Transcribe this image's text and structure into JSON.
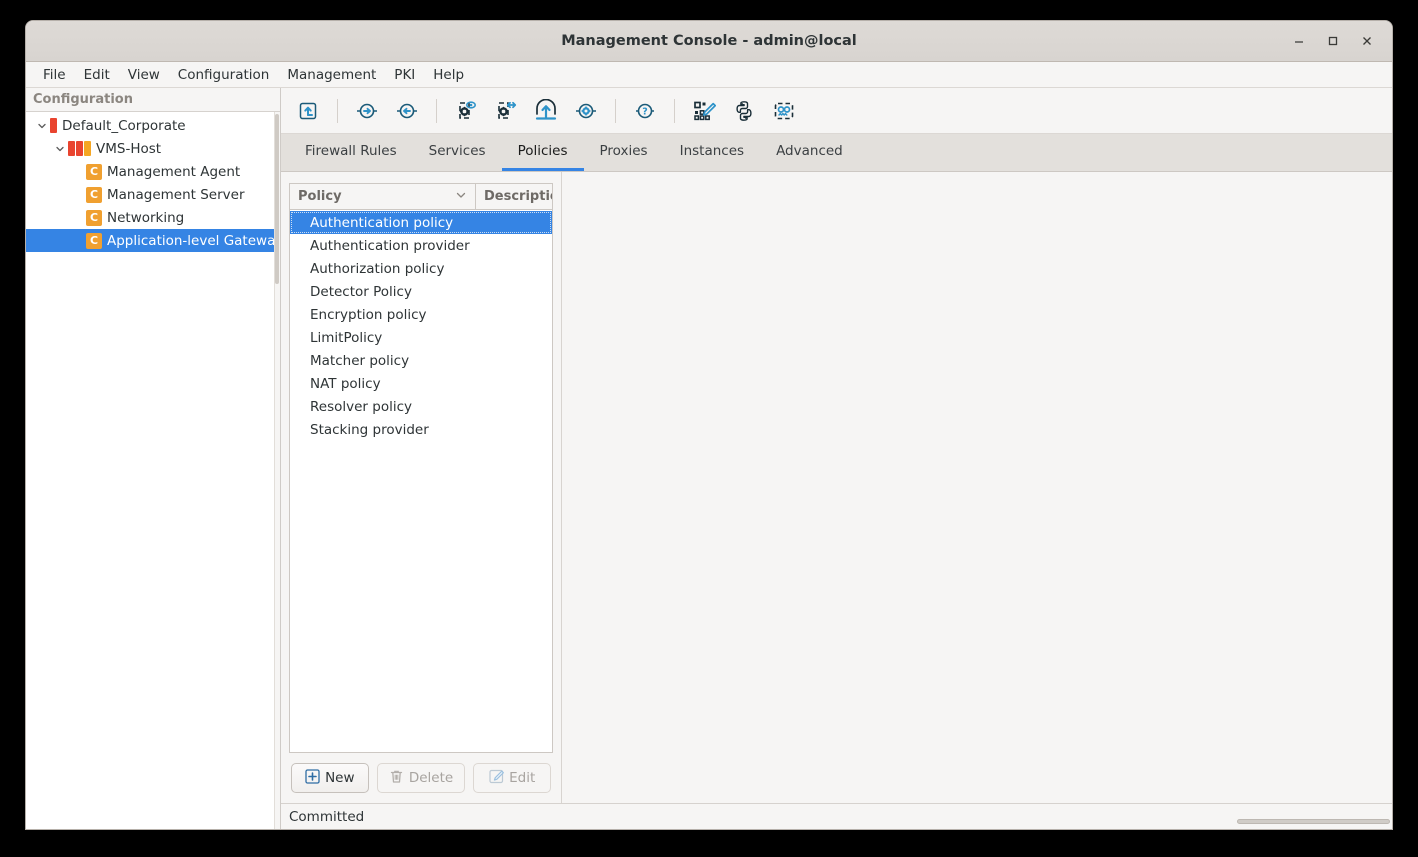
{
  "window": {
    "title": "Management Console - admin@local",
    "controls": [
      {
        "name": "minimize",
        "glyph": "–"
      },
      {
        "name": "maximize",
        "glyph": "□"
      },
      {
        "name": "close",
        "glyph": "✕"
      }
    ]
  },
  "menubar": {
    "items": [
      "File",
      "Edit",
      "View",
      "Configuration",
      "Management",
      "PKI",
      "Help"
    ]
  },
  "sidebar": {
    "header": "Configuration",
    "tree": [
      {
        "label": "Default_Corporate",
        "icon": "red-bar-icon",
        "depth": 0,
        "expanded": true,
        "selected": false
      },
      {
        "label": "VMS-Host",
        "icon": "triple-bar-icon",
        "depth": 1,
        "expanded": true,
        "selected": false
      },
      {
        "label": "Management Agent",
        "icon": "component-icon",
        "depth": 2,
        "expanded": null,
        "selected": false
      },
      {
        "label": "Management Server",
        "icon": "component-icon",
        "depth": 2,
        "expanded": null,
        "selected": false
      },
      {
        "label": "Networking",
        "icon": "component-icon",
        "depth": 2,
        "expanded": null,
        "selected": false
      },
      {
        "label": "Application-level Gateway",
        "icon": "component-icon",
        "depth": 2,
        "expanded": null,
        "selected": true
      }
    ],
    "component_badge": "C"
  },
  "toolbar": {
    "buttons": [
      {
        "name": "go-to-parent-icon",
        "tooltip": "Go to parent"
      },
      {
        "name": "forward-icon",
        "tooltip": "Forward"
      },
      {
        "name": "back-icon",
        "tooltip": "Back"
      },
      {
        "name": "view-config-icon",
        "tooltip": "View configuration"
      },
      {
        "name": "transfer-config-icon",
        "tooltip": "Transfer configuration"
      },
      {
        "name": "upload-icon",
        "tooltip": "Upload"
      },
      {
        "name": "settings-icon",
        "tooltip": "Settings"
      },
      {
        "name": "help-icon",
        "tooltip": "Help"
      },
      {
        "name": "qr-edit-icon",
        "tooltip": "Edit"
      },
      {
        "name": "python-icon",
        "tooltip": "Python"
      },
      {
        "name": "robot-icon",
        "tooltip": "Automation"
      }
    ]
  },
  "tabs": {
    "items": [
      "Firewall Rules",
      "Services",
      "Policies",
      "Proxies",
      "Instances",
      "Advanced"
    ],
    "active": "Policies"
  },
  "policy_list": {
    "columns": [
      "Policy",
      "Description"
    ],
    "sort_indicator": "chevron-down-icon",
    "rows": [
      "Authentication policy",
      "Authentication provider",
      "Authorization policy",
      "Detector Policy",
      "Encryption policy",
      "LimitPolicy",
      "Matcher policy",
      "NAT policy",
      "Resolver policy",
      "Stacking provider"
    ],
    "selected": "Authentication policy",
    "buttons": [
      {
        "label": "New",
        "icon": "plus-icon",
        "enabled": true
      },
      {
        "label": "Delete",
        "icon": "trash-icon",
        "enabled": false
      },
      {
        "label": "Edit",
        "icon": "pencil-icon",
        "enabled": false
      }
    ]
  },
  "statusbar": {
    "text": "Committed"
  },
  "colors": {
    "accent": "#3584e4",
    "icon_dark": "#1a5a78",
    "icon_blue": "#2e93c9",
    "tree_red": "#e9442f",
    "tree_orange": "#f0a030",
    "window_bg": "#f6f5f4"
  }
}
